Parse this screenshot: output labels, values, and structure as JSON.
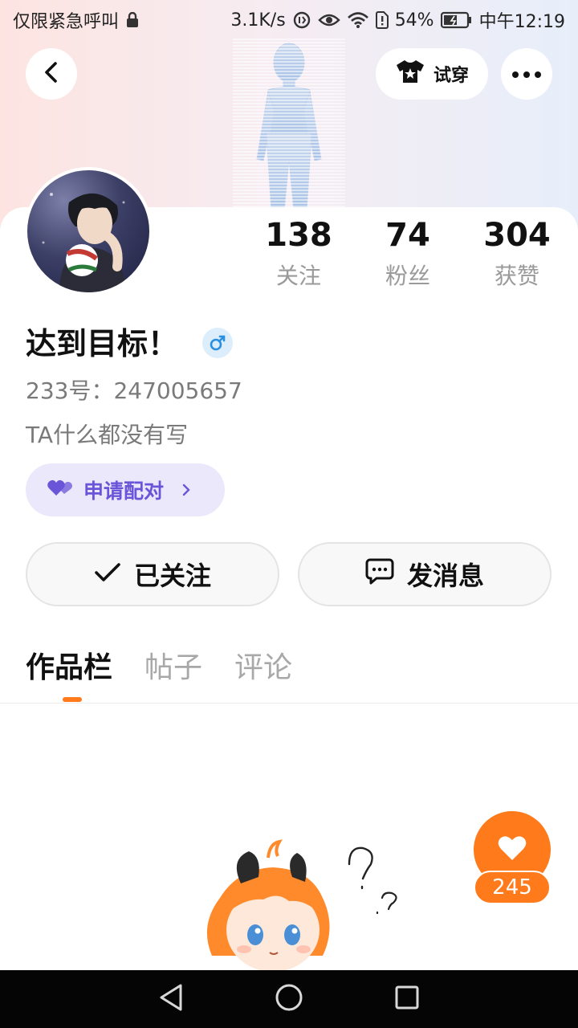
{
  "status_bar": {
    "carrier_text": "仅限紧急呼叫",
    "speed": "3.1K/s",
    "battery": "54%",
    "time": "中午12:19"
  },
  "header": {
    "tryon_label": "试穿"
  },
  "profile": {
    "name": "达到目标！",
    "gender_icon": "male-icon",
    "uid": "233号：247005657",
    "bio": "TA什么都没有写",
    "pair_label": "申请配对"
  },
  "stats": [
    {
      "value": "138",
      "label": "关注"
    },
    {
      "value": "74",
      "label": "粉丝"
    },
    {
      "value": "304",
      "label": "获赞"
    }
  ],
  "actions": {
    "follow_label": "已关注",
    "message_label": "发消息"
  },
  "tabs": [
    {
      "label": "作品栏",
      "active": true
    },
    {
      "label": "帖子",
      "active": false
    },
    {
      "label": "评论",
      "active": false
    }
  ],
  "like": {
    "count": "245"
  },
  "colors": {
    "accent": "#ff7a1a",
    "pair_purple": "#6a55d8",
    "pair_bg": "#ece8fb"
  }
}
